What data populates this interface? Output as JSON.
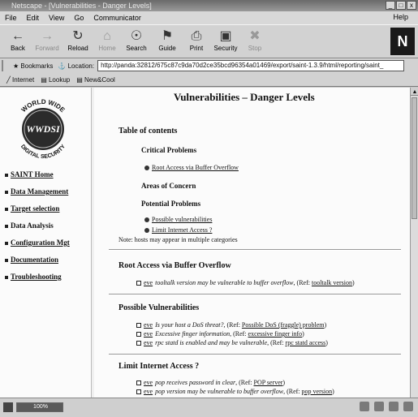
{
  "window": {
    "title": "Netscape - [Vulnerabilities - Danger Levels]",
    "buttons": [
      "_",
      "□",
      "x"
    ]
  },
  "menu": [
    "File",
    "Edit",
    "View",
    "Go",
    "Communicator"
  ],
  "menu_help": "Help",
  "toolbar": {
    "back": "Back",
    "forward": "Forward",
    "reload": "Reload",
    "home": "Home",
    "search": "Search",
    "guide": "Guide",
    "print": "Print",
    "security": "Security",
    "stop": "Stop",
    "logo": "N"
  },
  "location": {
    "bookmarks": "Bookmarks",
    "label": "Location:",
    "url": "http://panda:32812/675c87c9da70d2ce35bcd96354a01469/export/saint-1.3.9/html/reporting/saint_"
  },
  "personal": {
    "items": [
      "Internet",
      "Lookup",
      "New&Cool"
    ]
  },
  "logo": {
    "top_text": "WORLD WIDE",
    "center": "WWDSI",
    "bottom_text": "DIGITAL SECURITY"
  },
  "nav": [
    {
      "label": "SAINT Home",
      "link": true
    },
    {
      "label": "Data Management",
      "link": true
    },
    {
      "label": "Target selection",
      "link": true
    },
    {
      "label": "Data Analysis",
      "link": false
    },
    {
      "label": "Configuration Mgt",
      "link": true
    },
    {
      "label": "Documentation",
      "link": true
    },
    {
      "label": "Troubleshooting",
      "link": true
    }
  ],
  "page": {
    "title": "Vulnerabilities – Danger Levels",
    "toc_heading": "Table of contents",
    "critical": "Critical Problems",
    "critical_link": "Root Access via Buffer Overflow",
    "areas": "Areas of Concern",
    "potential": "Potential Problems",
    "potential_link1": "Possible vulnerabilities",
    "potential_link2": "Limit Internet Access ?",
    "note": "Note: hosts may appear in multiple categories"
  },
  "sections": [
    {
      "heading": "Root Access via Buffer Overflow",
      "items": [
        {
          "host": "eve",
          "desc": "tooltalk version may be vulnerable to buffer overflow",
          "ref_pre": ", (Ref:",
          "ref": "tooltalk version",
          "ref_post": ")"
        }
      ]
    },
    {
      "heading": "Possible Vulnerabilities",
      "items": [
        {
          "host": "eve",
          "desc": "Is your host a DoS threat?",
          "ref_pre": ", (Ref:",
          "ref": "Possible DoS (fraggle) problem",
          "ref_post": ")"
        },
        {
          "host": "eve",
          "desc": "Excessive finger information",
          "ref_pre": ", (Ref:",
          "ref": "excessive finger info",
          "ref_post": ")"
        },
        {
          "host": "eve",
          "desc": "rpc statd is enabled and may be vulnerable",
          "ref_pre": ", (Ref:",
          "ref": "rpc statd access",
          "ref_post": ")"
        }
      ]
    },
    {
      "heading": "Limit Internet Access ?",
      "items": [
        {
          "host": "eve",
          "desc": "pop receives password in clear",
          "ref_pre": ", (Ref:",
          "ref": "POP server",
          "ref_post": ")"
        },
        {
          "host": "eve",
          "desc": "pop version may be vulnerable to buffer overflow",
          "ref_pre": ", (Ref:",
          "ref": "pop version",
          "ref_post": ")"
        }
      ]
    }
  ],
  "status": {
    "progress_label": "100%",
    "progress": 1.0
  }
}
